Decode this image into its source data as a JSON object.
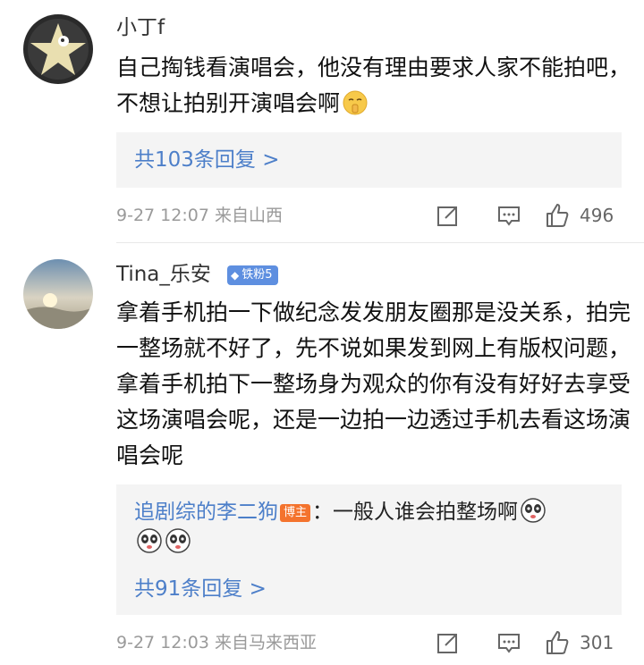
{
  "comments": [
    {
      "username": "小丁f",
      "text": "自己掏钱看演唱会，他没有理由要求人家不能拍吧，不想让拍别开演唱会啊",
      "reply_link": "共103条回复 >",
      "meta": "9-27 12:07  来自山西",
      "likes": "496",
      "emoji": "shush-face-emoji"
    },
    {
      "username": "Tina_乐安",
      "badge": "铁粉5",
      "text": "拿着手机拍一下做纪念发发朋友圈那是没关系，拍完一整场就不好了，先不说如果发到网上有版权问题，拿着手机拍下一整场身为观众的你有没有好好去享受这场演唱会呢，还是一边拍一边透过手机去看这场演唱会呢",
      "sub_comment": {
        "author": "追剧综的李二狗",
        "author_tag": "博主",
        "text": "：一般人谁会拍整场啊"
      },
      "reply_link": "共91条回复 >",
      "meta": "9-27 12:03  来自马来西亚",
      "likes": "301"
    }
  ],
  "icons": {
    "share": "share-icon",
    "comment": "comment-icon",
    "like": "thumb-up-icon",
    "badge": "diamond-icon"
  },
  "colors": {
    "link": "#4d7fc9",
    "badge": "#5e8fe0",
    "author_tag": "#f4732d"
  }
}
